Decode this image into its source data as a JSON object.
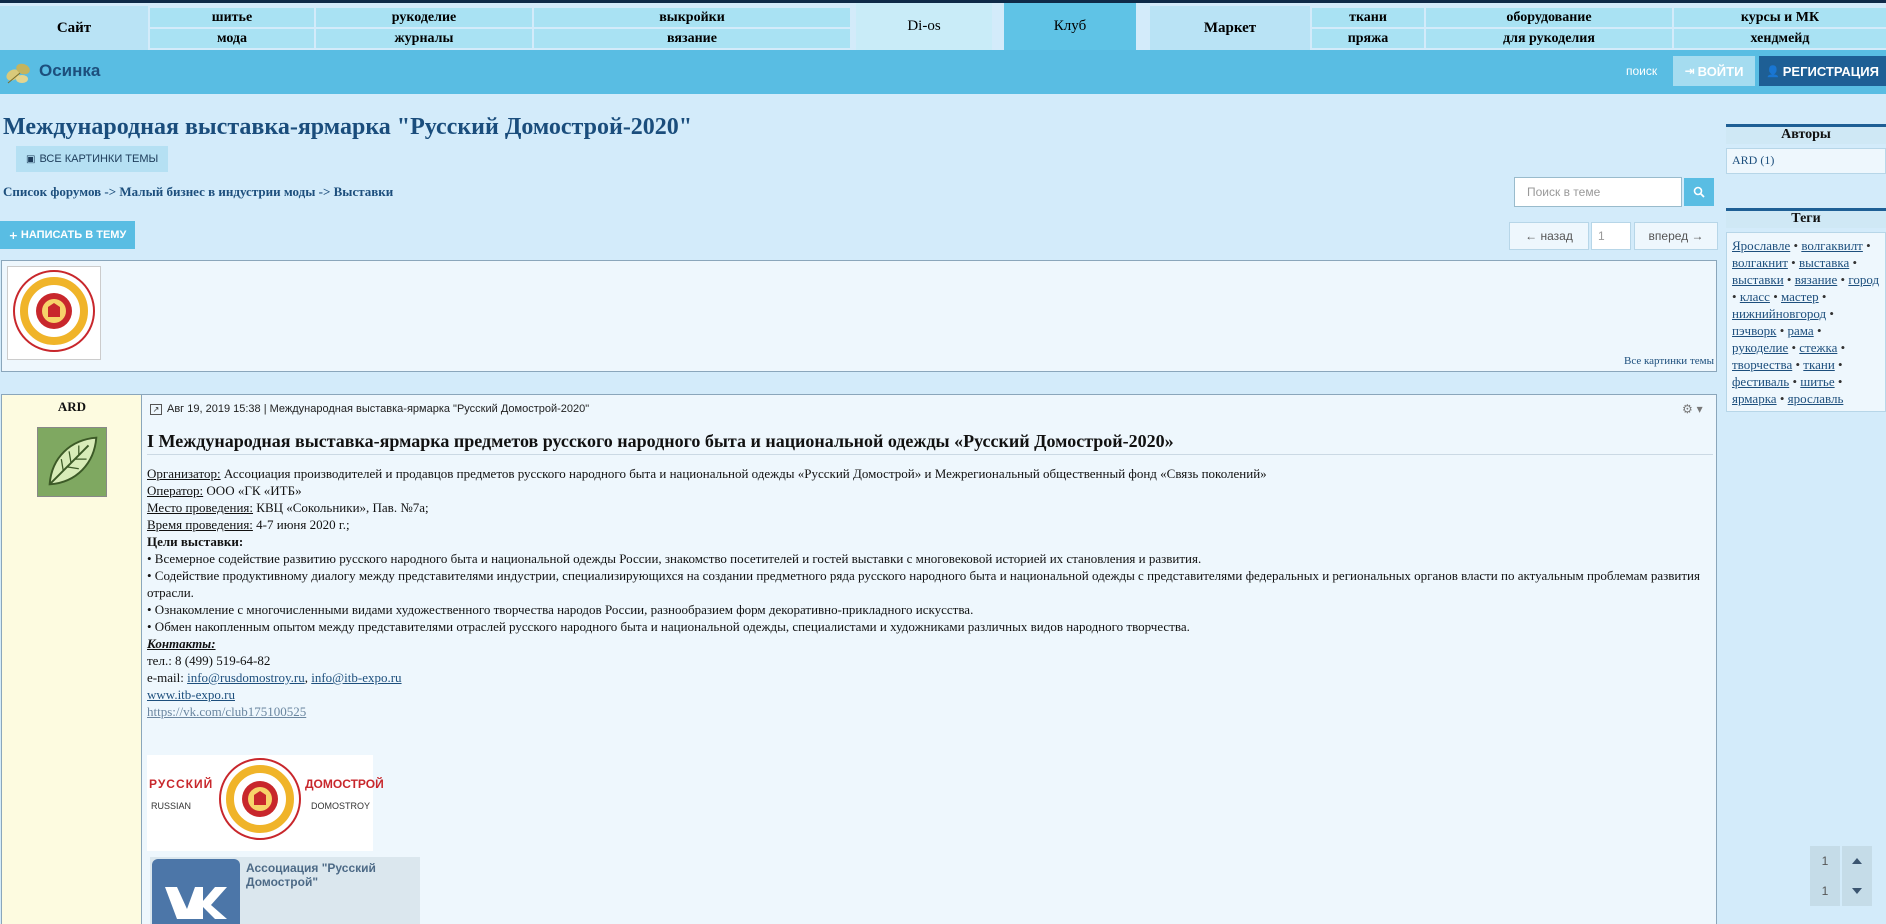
{
  "nav": {
    "site": "Сайт",
    "group1": [
      "шитье",
      "рукоделие",
      "выкройки",
      "мода",
      "журналы",
      "вязание"
    ],
    "dios": "Di-os",
    "club": "Клуб",
    "market": "Маркет",
    "group2": [
      "ткани",
      "оборудование",
      "курсы и МК",
      "пряжа",
      "для рукоделия",
      "хендмейд"
    ]
  },
  "header": {
    "brand": "Осинка",
    "search": "поиск",
    "login": "ВОЙТИ",
    "register": "РЕГИСТРАЦИЯ"
  },
  "topic": {
    "title": "Международная выставка-ярмарка \"Русский Домострой-2020\"",
    "all_pictures": "ВСЕ КАРТИНКИ ТЕМЫ",
    "breadcrumb": [
      "Список форумов",
      "Малый бизнес в индустрии моды",
      "Выставки"
    ],
    "breadcrumb_sep": "->",
    "search_placeholder": "Поиск в теме",
    "write": "НАПИСАТЬ В ТЕМУ",
    "prev": "← назад",
    "page": "1",
    "next": "вперед →",
    "thumbs_link": "Все картинки темы"
  },
  "post": {
    "author": "ARD",
    "meta": "Авг 19, 2019 15:38 | Международная выставка-ярмарка \"Русский Домострой-2020\"",
    "heading": "I Международная выставка-ярмарка предметов русского народного быта и национальной одежды «Русский Домострой-2020»",
    "org_label": "Организатор:",
    "org_value": " Ассоциация производителей и продавцов предметов русского народного быта и национальной одежды «Русский Домострой» и Межрегиональный общественный фонд «Связь поколений»",
    "op_label": "Оператор:",
    "op_value": " ООО «ГК «ИТБ»",
    "place_label": "Место проведения:",
    "place_value": " КВЦ «Сокольники», Пав. №7а;",
    "time_label": "Время проведения:",
    "time_value": " 4-7 июня 2020 г.;",
    "goals_label": "Цели выставки:",
    "goal1": "• Всемерное содействие развитию русского народного быта и национальной одежды России, знакомство посетителей и гостей выставки с многовековой историей их становления и развития.",
    "goal2": "• Содействие продуктивному диалогу между представителями индустрии, специализирующихся на создании предметного ряда русского народного быта и национальной одежды с представителями федеральных и региональных органов власти по актуальным проблемам развития отрасли.",
    "goal3": "• Ознакомление с многочисленными видами художественного творчества народов России, разнообразием форм декоративно-прикладного искусства.",
    "goal4": "• Обмен накопленным опытом между представителями отраслей русского народного быта и национальной одежды, специалистами и художниками различных видов народного творчества.",
    "contacts_label": "Контакты:",
    "phone": "тел.: 8 (499) 519-64-82",
    "email_label": "e-mail: ",
    "email1": "info@rusdomostroy.ru",
    "email_sep": ", ",
    "email2": "info@itb-expo.ru",
    "site": "www.itb-expo.ru",
    "vk": "https://vk.com/club175100525",
    "logo_left": "РУССКИЙ",
    "logo_right": "ДОМОСТРОЙ",
    "logo_left_en": "RUSSIAN",
    "logo_right_en": "DOMOSTROY",
    "vk_card_name": "Ассоциация \"Русский Домострой\""
  },
  "sidebar": {
    "authors_title": "Авторы",
    "authors": [
      "ARD (1)"
    ],
    "tags_title": "Теги",
    "tags": [
      "Ярославле",
      "волгаквилт",
      "волгакнит",
      "выставка",
      "выставки",
      "вязание",
      "город",
      "класс",
      "мастер",
      "нижнийновгород",
      "пэчворк",
      "рама",
      "рукоделие",
      "стежка",
      "творчества",
      "ткани",
      "фестиваль",
      "шитье",
      "ярмарка",
      "ярославль"
    ],
    "tag_sep": " • "
  },
  "scroll": {
    "top_page": "1",
    "bottom_page": "1"
  },
  "colors": {
    "nav_bg": "#a9e2f3",
    "header_bg": "#59bde3",
    "accent_dark": "#1e5f95",
    "link": "#1d4f7d"
  }
}
